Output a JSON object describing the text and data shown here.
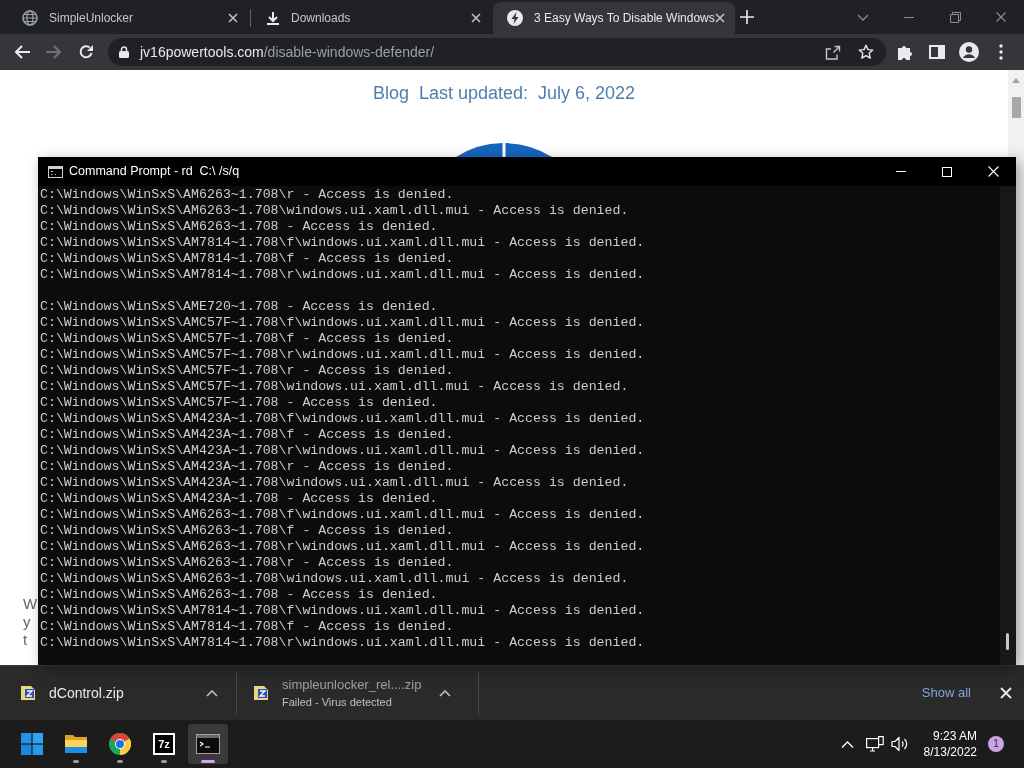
{
  "browser": {
    "tabs": [
      {
        "title": "SimpleUnlocker",
        "kind": "web",
        "selected": false
      },
      {
        "title": "Downloads",
        "kind": "downloads",
        "selected": false
      },
      {
        "title": "3 Easy Ways To Disable Windows",
        "kind": "site",
        "selected": true
      }
    ],
    "nav_buttons": [
      {
        "kind": "back",
        "disabled": false
      },
      {
        "kind": "forward",
        "disabled": true
      },
      {
        "kind": "reload",
        "disabled": false
      }
    ],
    "address": {
      "host": "jv16powertools.com",
      "path": "/disable-windows-defender/"
    },
    "page": {
      "category": "Blog",
      "updated": "Last updated:  July 6, 2022",
      "covered_text": [
        "W",
        "y",
        "t"
      ]
    },
    "downloads": {
      "items": [
        {
          "name": "dControl.zip",
          "failed": false
        },
        {
          "name": "simpleunlocker_rel....zip",
          "failed": true,
          "status": "Failed - Virus detected"
        }
      ],
      "show_all": "Show all"
    }
  },
  "console": {
    "title": "Command Prompt - rd  C:\\ /s/q",
    "blocks": [
      [
        "C:\\Windows\\WinSxS\\AM6263~1.708\\r - Access is denied.",
        "C:\\Windows\\WinSxS\\AM6263~1.708\\windows.ui.xaml.dll.mui - Access is denied.",
        "C:\\Windows\\WinSxS\\AM6263~1.708 - Access is denied.",
        "C:\\Windows\\WinSxS\\AM7814~1.708\\f\\windows.ui.xaml.dll.mui - Access is denied.",
        "C:\\Windows\\WinSxS\\AM7814~1.708\\f - Access is denied.",
        "C:\\Windows\\WinSxS\\AM7814~1.708\\r\\windows.ui.xaml.dll.mui - Access is denied."
      ],
      [
        "C:\\Windows\\WinSxS\\AME720~1.708 - Access is denied.",
        "C:\\Windows\\WinSxS\\AMC57F~1.708\\f\\windows.ui.xaml.dll.mui - Access is denied.",
        "C:\\Windows\\WinSxS\\AMC57F~1.708\\f - Access is denied.",
        "C:\\Windows\\WinSxS\\AMC57F~1.708\\r\\windows.ui.xaml.dll.mui - Access is denied.",
        "C:\\Windows\\WinSxS\\AMC57F~1.708\\r - Access is denied.",
        "C:\\Windows\\WinSxS\\AMC57F~1.708\\windows.ui.xaml.dll.mui - Access is denied.",
        "C:\\Windows\\WinSxS\\AMC57F~1.708 - Access is denied.",
        "C:\\Windows\\WinSxS\\AM423A~1.708\\f\\windows.ui.xaml.dll.mui - Access is denied.",
        "C:\\Windows\\WinSxS\\AM423A~1.708\\f - Access is denied.",
        "C:\\Windows\\WinSxS\\AM423A~1.708\\r\\windows.ui.xaml.dll.mui - Access is denied.",
        "C:\\Windows\\WinSxS\\AM423A~1.708\\r - Access is denied.",
        "C:\\Windows\\WinSxS\\AM423A~1.708\\windows.ui.xaml.dll.mui - Access is denied.",
        "C:\\Windows\\WinSxS\\AM423A~1.708 - Access is denied.",
        "C:\\Windows\\WinSxS\\AM6263~1.708\\f\\windows.ui.xaml.dll.mui - Access is denied.",
        "C:\\Windows\\WinSxS\\AM6263~1.708\\f - Access is denied.",
        "C:\\Windows\\WinSxS\\AM6263~1.708\\r\\windows.ui.xaml.dll.mui - Access is denied.",
        "C:\\Windows\\WinSxS\\AM6263~1.708\\r - Access is denied.",
        "C:\\Windows\\WinSxS\\AM6263~1.708\\windows.ui.xaml.dll.mui - Access is denied.",
        "C:\\Windows\\WinSxS\\AM6263~1.708 - Access is denied.",
        "C:\\Windows\\WinSxS\\AM7814~1.708\\f\\windows.ui.xaml.dll.mui - Access is denied.",
        "C:\\Windows\\WinSxS\\AM7814~1.708\\f - Access is denied.",
        "C:\\Windows\\WinSxS\\AM7814~1.708\\r\\windows.ui.xaml.dll.mui - Access is denied."
      ]
    ]
  },
  "taskbar": {
    "apps": [
      {
        "kind": "start",
        "running": false,
        "active": false
      },
      {
        "kind": "explorer",
        "running": true,
        "active": false
      },
      {
        "kind": "chrome",
        "running": true,
        "active": false
      },
      {
        "kind": "archiver",
        "label": "7z",
        "running": true,
        "active": false
      },
      {
        "kind": "terminal",
        "running": true,
        "active": true
      }
    ],
    "time": "9:23 AM",
    "date": "8/13/2022",
    "notifications": "1"
  }
}
